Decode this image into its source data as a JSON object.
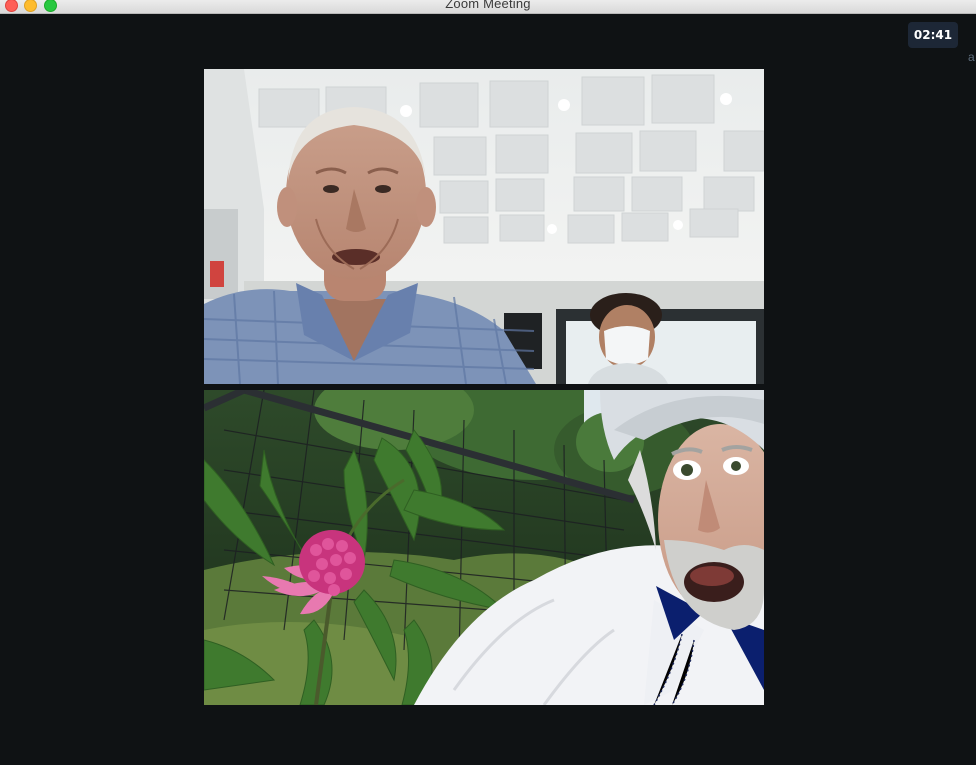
{
  "window": {
    "title": "Zoom Meeting",
    "traffic_lights": [
      "close",
      "minimize",
      "zoom"
    ]
  },
  "meeting": {
    "elapsed_time": "02:41"
  },
  "edge_glyph": "a",
  "participants": [
    {
      "tile": "upper",
      "scene": "indoor-room"
    },
    {
      "tile": "lower",
      "scene": "outdoor-garden"
    }
  ],
  "colors": {
    "background": "#0f1214",
    "timer_bg": "#1d2736"
  }
}
